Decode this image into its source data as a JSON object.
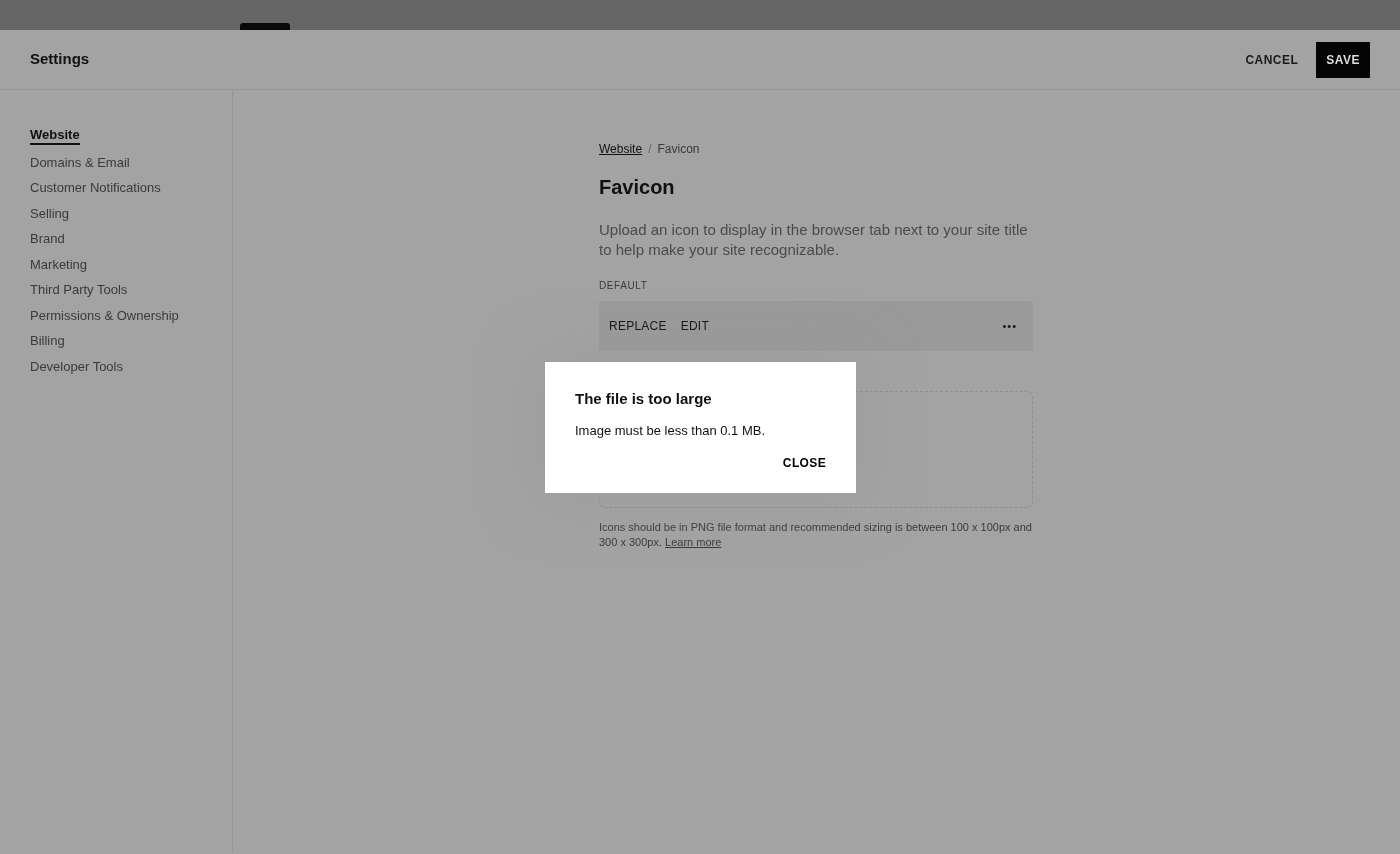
{
  "header": {
    "title": "Settings",
    "buttons": [
      {
        "label": "CANCEL",
        "kind": "text"
      },
      {
        "label": "SAVE",
        "kind": "primary"
      }
    ]
  },
  "sidebar": {
    "items": [
      {
        "label": "Website",
        "selected": true
      },
      {
        "label": "Domains & Email",
        "selected": false
      },
      {
        "label": "Customer Notifications",
        "selected": false
      },
      {
        "label": "Selling",
        "selected": false
      },
      {
        "label": "Brand",
        "selected": false
      },
      {
        "label": "Marketing",
        "selected": false
      },
      {
        "label": "Third Party Tools",
        "selected": false
      },
      {
        "label": "Permissions & Ownership",
        "selected": false
      },
      {
        "label": "Billing",
        "selected": false
      },
      {
        "label": "Developer Tools",
        "selected": false
      }
    ]
  },
  "breadcrumb": [
    {
      "label": "Website",
      "kind": "link"
    },
    {
      "label": "/",
      "kind": "separator"
    },
    {
      "label": "Favicon",
      "kind": "current"
    }
  ],
  "page": {
    "title": "Favicon",
    "description": "Upload an icon to display in the browser tab next to your site title to help make your site recognizable.",
    "section_label": "DEFAULT",
    "actions": [
      "REPLACE",
      "EDIT"
    ],
    "more": "•••",
    "hint": "Icons should be in PNG file format and recommended sizing is between 100 x 100px and 300 x 300px.",
    "hint_link": "Learn more"
  },
  "dialog": {
    "title": "The file is too large",
    "message": "Image must be less than 0.1 MB.",
    "button": "CLOSE"
  }
}
